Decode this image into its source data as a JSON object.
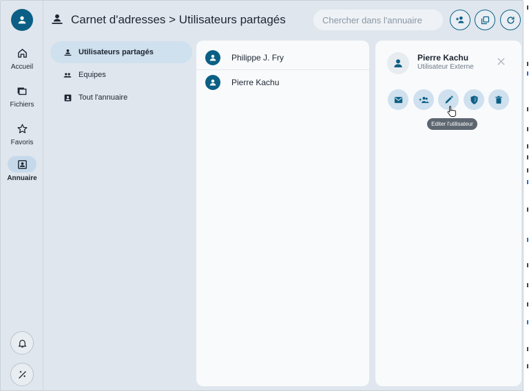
{
  "nav": {
    "items": [
      {
        "label": "Accueil",
        "icon": "home-icon"
      },
      {
        "label": "Fichiers",
        "icon": "files-icon"
      },
      {
        "label": "Favoris",
        "icon": "star-icon"
      },
      {
        "label": "Annuaire",
        "icon": "contact-card-icon",
        "active": true
      }
    ],
    "bottom": [
      "bell-icon",
      "theme-icon"
    ]
  },
  "header": {
    "breadcrumb": "Carnet d'adresses > Utilisateurs partagés",
    "search_placeholder": "Chercher dans l'annuaire",
    "actions": [
      "add-user-icon",
      "copy-icon",
      "refresh-icon"
    ]
  },
  "menu": {
    "items": [
      {
        "label": "Utilisateurs partagés",
        "active": true
      },
      {
        "label": "Equipes"
      },
      {
        "label": "Tout l'annuaire"
      }
    ]
  },
  "list": {
    "users": [
      "Philippe J. Fry",
      "Pierre Kachu"
    ]
  },
  "detail": {
    "name": "Pierre Kachu",
    "subtitle": "Utilisateur Externe",
    "actions": [
      "mail-icon",
      "add-to-group-icon",
      "edit-icon",
      "security-icon",
      "delete-icon"
    ],
    "tooltip": "Editer l'utilisateur"
  },
  "colors": {
    "accent": "#0b5f84",
    "surface": "#dfe6ed",
    "panel": "#f8fafc",
    "active_pill": "#cfe0ef"
  }
}
